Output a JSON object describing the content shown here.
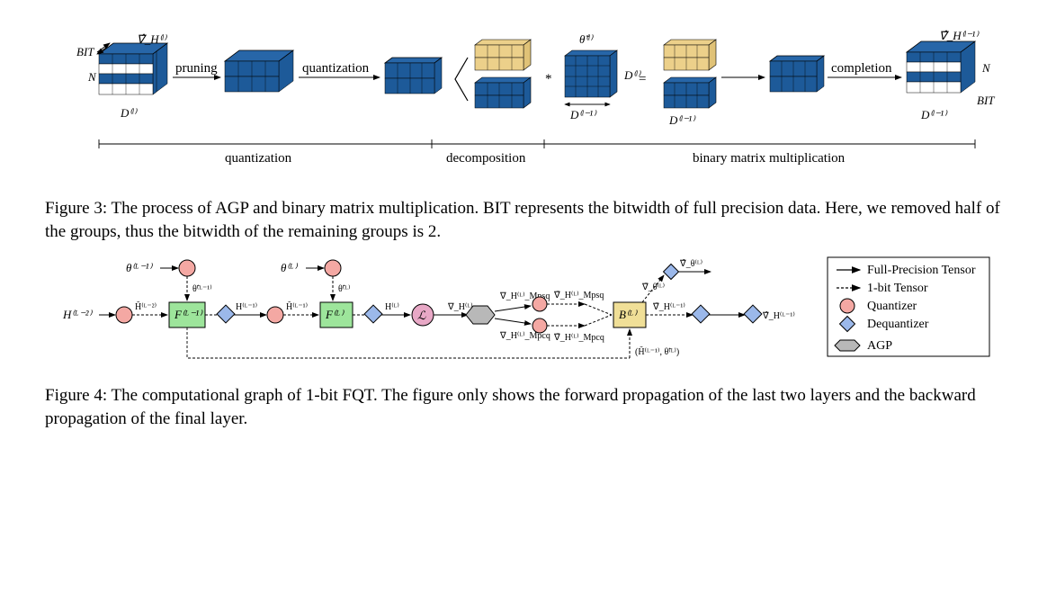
{
  "fig3": {
    "bit_top_left": "BIT",
    "n_left": "N",
    "d_left": "D⁽ˡ⁾",
    "gradH_l": "∇̂_H⁽ˡ⁾",
    "op_pruning": "pruning",
    "op_quantization_a": "quantization",
    "theta_tilde_l": "θ̃⁽ˡ⁾",
    "star": "*",
    "d_prev1": "D⁽ˡ⁻¹⁾",
    "d_l_mid": "D⁽ˡ⁾",
    "equals": "=",
    "d_prev2": "D⁽ˡ⁻¹⁾",
    "op_completion": "completion",
    "gradH_l_1": "∇̂_H⁽ˡ⁻¹⁾",
    "n_right": "N",
    "bit_right": "BIT",
    "d_prev3": "D⁽ˡ⁻¹⁾",
    "sec_quant": "quantization",
    "sec_decomp": "decomposition",
    "sec_bmm": "binary matrix multiplication",
    "caption": "Figure 3: The process of AGP and binary matrix multiplication. BIT represents the bitwidth of full precision data. Here, we removed half of the groups, thus the bitwidth of the remaining groups is 2."
  },
  "fig4": {
    "theta_lm1": "θ⁽ᴸ⁻¹⁾",
    "theta_l": "θ⁽ᴸ⁾",
    "theta_tilde_lm1": "θ̃⁽ᴸ⁻¹⁾",
    "theta_tilde_l": "θ̃⁽ᴸ⁾",
    "h_lm2": "H⁽ᴸ⁻²⁾",
    "h_tilde_lm2": "H̃⁽ᴸ⁻²⁾",
    "f_lm1": "F⁽ᴸ⁻¹⁾",
    "h_lm1": "H⁽ᴸ⁻¹⁾",
    "h_tilde_lm1": "H̃⁽ᴸ⁻¹⁾",
    "f_l": "F⁽ᴸ⁾",
    "h_l": "H⁽ᴸ⁾",
    "loss": "ℒ",
    "grad_hl": "∇_H⁽ᴸ⁾",
    "grad_hl_psq": "∇_H⁽ᴸ⁾_Mpsq",
    "grad_hl_pcq": "∇_H⁽ᴸ⁾_Mpcq",
    "grad_hl_psq2": "∇̄_H⁽ᴸ⁾_Mpsq",
    "grad_hl_pcq2": "∇̄_H⁽ᴸ⁾_Mpcq",
    "b_l": "B⁽ᴸ⁾",
    "grad_theta_l": "∇̂_θ⁽ᴸ⁾",
    "grad_theta_l_bar": "∇̄_θ⁽ᴸ⁾",
    "grad_h_lm1_bar": "∇̄_H⁽ᴸ⁻¹⁾",
    "grad_h_lm1_hat": "∇̂_H⁽ᴸ⁻¹⁾",
    "inputs_b": "(H̃⁽ᴸ⁻¹⁾, θ̃⁽ᴸ⁾)",
    "legend": {
      "fp": "Full-Precision Tensor",
      "bit1": "1-bit Tensor",
      "quant": "Quantizer",
      "dequant": "Dequantizer",
      "agp": "AGP"
    },
    "caption": "Figure 4: The computational graph of 1-bit FQT. The figure only shows the forward propagation of the last two layers and the backward propagation of the final layer."
  }
}
